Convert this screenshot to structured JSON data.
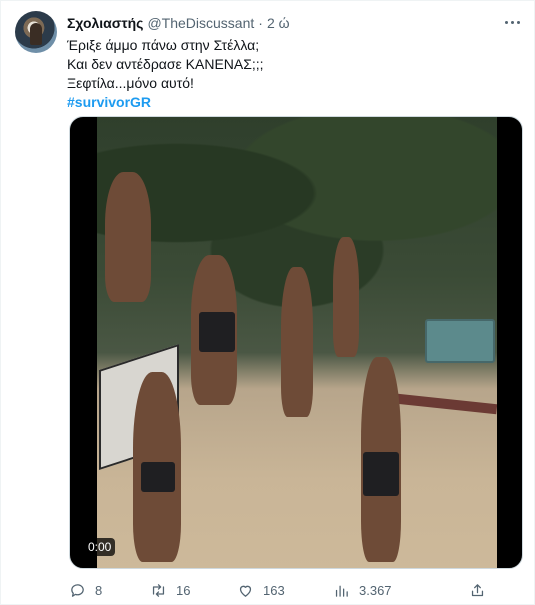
{
  "tweet": {
    "display_name": "Σχολιαστής",
    "handle": "@TheDiscussant",
    "separator": "·",
    "time": "2 ώ",
    "lines": [
      "Έριξε άμμο πάνω στην Στέλλα;",
      "Και δεν αντέδρασε ΚΑΝΕΝΑΣ;;;",
      "Ξεφτίλα...μόνο αυτό!"
    ],
    "hashtag": "#survivorGR"
  },
  "media": {
    "timestamp": "0:00"
  },
  "actions": {
    "replies": "8",
    "retweets": "16",
    "likes": "163",
    "views": "3.367"
  },
  "icons": {
    "more": "more-icon",
    "reply": "reply-icon",
    "retweet": "retweet-icon",
    "like": "heart-icon",
    "views": "views-icon",
    "share": "share-icon"
  },
  "colors": {
    "accent": "#1d9bf0",
    "muted": "#536471",
    "text": "#0f1419"
  }
}
